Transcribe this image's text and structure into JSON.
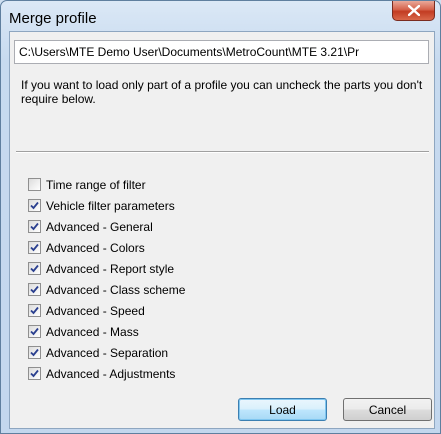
{
  "window": {
    "title": "Merge profile",
    "close_icon": "close-icon"
  },
  "path_field": {
    "value": "C:\\Users\\MTE Demo User\\Documents\\MetroCount\\MTE 3.21\\Pr"
  },
  "info_text": "If you want to load only part of a profile you can uncheck the parts you don't require below.",
  "options": [
    {
      "label": "Time range of filter",
      "checked": false
    },
    {
      "label": "Vehicle filter parameters",
      "checked": true
    },
    {
      "label": "Advanced - General",
      "checked": true
    },
    {
      "label": "Advanced - Colors",
      "checked": true
    },
    {
      "label": "Advanced - Report style",
      "checked": true
    },
    {
      "label": "Advanced - Class scheme",
      "checked": true
    },
    {
      "label": "Advanced - Speed",
      "checked": true
    },
    {
      "label": "Advanced - Mass",
      "checked": true
    },
    {
      "label": "Advanced - Separation",
      "checked": true
    },
    {
      "label": "Advanced - Adjustments",
      "checked": true
    }
  ],
  "buttons": {
    "load": "Load",
    "cancel": "Cancel"
  }
}
